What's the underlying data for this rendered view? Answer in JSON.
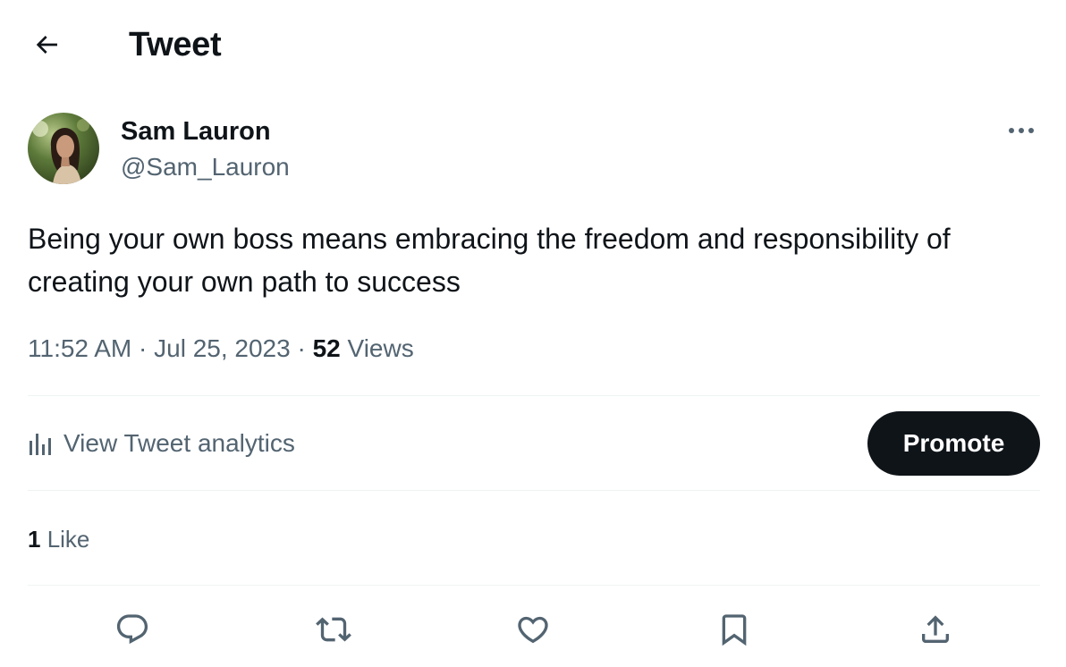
{
  "header": {
    "title": "Tweet",
    "back_icon": "arrow-left-icon"
  },
  "author": {
    "display_name": "Sam Lauron",
    "handle": "@Sam_Lauron",
    "more_icon": "more-horizontal-icon"
  },
  "tweet": {
    "text": "Being your own boss means embracing the freedom and responsibility of creating your own path to success",
    "time": "11:52 AM",
    "separator": " · ",
    "date": "Jul 25, 2023",
    "views_count": "52",
    "views_label": " Views"
  },
  "analytics": {
    "label": "View Tweet analytics",
    "icon": "analytics-bars-icon",
    "promote_label": "Promote"
  },
  "engagement": {
    "likes_count": "1",
    "likes_label": " Like"
  },
  "actions": [
    {
      "name": "reply",
      "icon": "reply-icon"
    },
    {
      "name": "retweet",
      "icon": "retweet-icon"
    },
    {
      "name": "like",
      "icon": "heart-icon"
    },
    {
      "name": "bookmark",
      "icon": "bookmark-icon"
    },
    {
      "name": "share",
      "icon": "share-icon"
    }
  ],
  "colors": {
    "text_primary": "#0f1419",
    "text_secondary": "#536471",
    "divider": "#eff3f4",
    "button_dark": "#0f1419"
  }
}
